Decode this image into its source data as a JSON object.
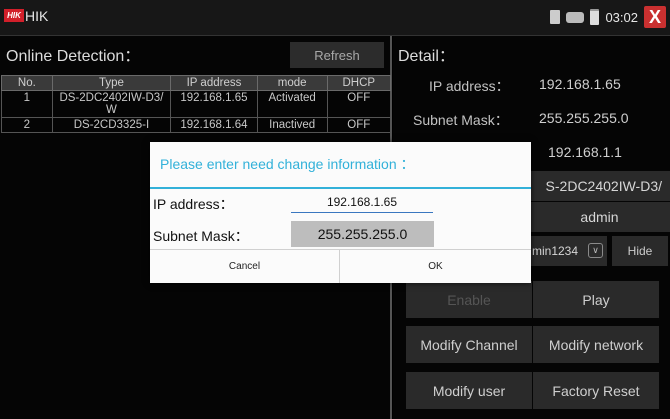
{
  "topbar": {
    "logo_text": "HIK",
    "title": "HIK",
    "clock": "03:02",
    "close_symbol": "X",
    "icons": [
      "calculator-icon",
      "network-icon",
      "battery-icon"
    ]
  },
  "online": {
    "title": "Online Detection：",
    "refresh_label": "Refresh",
    "columns": [
      "No.",
      "Type",
      "IP address",
      "mode",
      "DHCP"
    ],
    "rows": [
      {
        "no": "1",
        "type": "DS-2DC2402IW-D3/ W",
        "ip": "192.168.1.65",
        "mode": "Activated",
        "dhcp": "OFF"
      },
      {
        "no": "2",
        "type": "DS-2CD3325-I",
        "ip": "192.168.1.64",
        "mode": "Inactived",
        "dhcp": "OFF"
      }
    ]
  },
  "detail": {
    "title": "Detail：",
    "ip_label": "IP address：",
    "ip_value": "192.168.1.65",
    "mask_label": "Subnet Mask：",
    "mask_value": "255.255.255.0",
    "gateway_value": "192.168.1.1",
    "model_value": "S-2DC2402IW-D3/",
    "user_value": "admin",
    "password_value": "min1234",
    "hide_label": "Hide",
    "enable_label": "Enable",
    "play_label": "Play",
    "modify_channel_label": "Modify Channel",
    "modify_network_label": "Modify network",
    "modify_user_label": "Modify user",
    "factory_reset_label": "Factory Reset"
  },
  "dialog": {
    "title": "Please enter need change information ：",
    "ip_label": "IP address：",
    "ip_value": "192.168.1.65",
    "mask_label": "Subnet Mask：",
    "mask_value": "255.255.255.0",
    "cancel_label": "Cancel",
    "ok_label": "OK"
  },
  "colors": {
    "accent": "#32b1d9",
    "logo": "#d21f2a",
    "close": "#c93030"
  }
}
